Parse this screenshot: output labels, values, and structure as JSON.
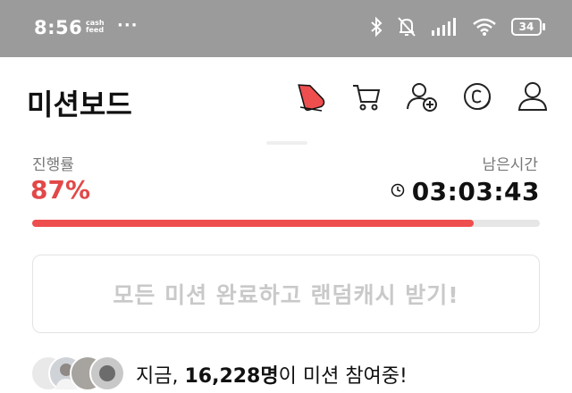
{
  "status_bar": {
    "time": "8:56",
    "notif_app": "cash feed",
    "more": "···",
    "icons": [
      "bluetooth-icon",
      "silent-bell-icon",
      "signal-icon",
      "wifi-icon"
    ],
    "battery": "34"
  },
  "header": {
    "title": "미션보드",
    "icons": [
      "shoe-icon",
      "cart-icon",
      "add-friend-icon",
      "coin-icon",
      "profile-icon"
    ]
  },
  "progress": {
    "label": "진행률",
    "value_text": "87%",
    "fraction": 0.87
  },
  "remaining": {
    "label": "남은시간",
    "time": "03:03:43"
  },
  "cta": {
    "label": "모든 미션 완료하고 랜덤캐시 받기!"
  },
  "participants": {
    "prefix": "지금, ",
    "count": "16,228명",
    "suffix": "이 미션 참여중!"
  },
  "colors": {
    "accent": "#ee4e4e",
    "status_bar": "#9b9b9b",
    "cta_text": "#c9c9c9"
  }
}
